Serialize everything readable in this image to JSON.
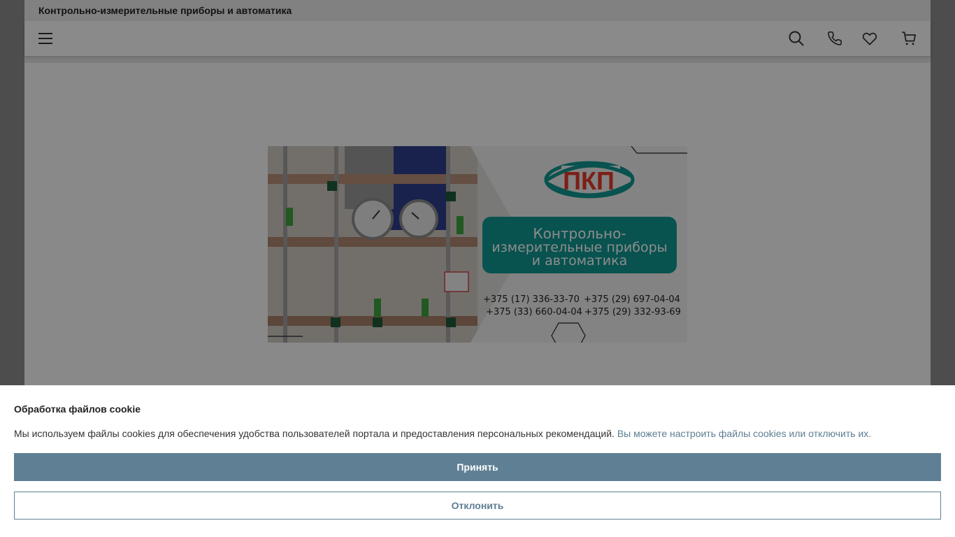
{
  "header": {
    "site_title": "Контрольно-измерительные приборы и автоматика"
  },
  "navbar": {
    "icons": [
      "menu-icon",
      "search-icon",
      "phone-icon",
      "heart-icon",
      "cart-icon"
    ]
  },
  "banner": {
    "logo_text": "ПКП",
    "headline_lines": [
      "Контрольно-",
      "измерительные приборы",
      "и автоматика"
    ],
    "phones": [
      "+375 (17) 336-33-70",
      "+375 (29) 697-04-04",
      "+375 (33) 660-04-04",
      "+375 (29) 332-93-69"
    ],
    "colors": {
      "teal": "#0f9690",
      "logo_red": "#e23a2a"
    }
  },
  "cookie": {
    "title": "Обработка файлов cookie",
    "text": "Мы используем файлы cookies для обеспечения удобства пользователей портала и предоставления персональных рекомендаций.",
    "link": "Вы можете настроить файлы cookies или отключить их.",
    "accept_label": "Принять",
    "decline_label": "Отклонить",
    "colors": {
      "accent": "#5f8094",
      "link": "#5d7d91"
    }
  }
}
